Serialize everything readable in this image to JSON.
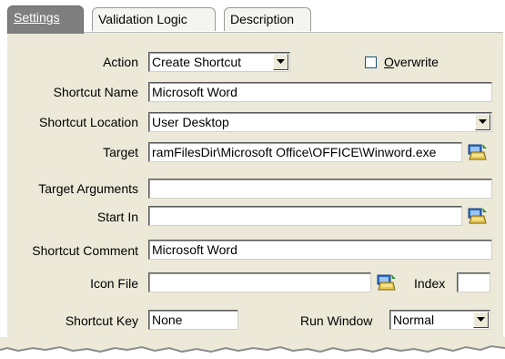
{
  "tabs": [
    {
      "label": "Settings",
      "active": true
    },
    {
      "label": "Validation Logic",
      "active": false
    },
    {
      "label": "Description",
      "active": false
    }
  ],
  "form": {
    "action": {
      "label": "Action",
      "value": "Create Shortcut"
    },
    "overwrite": {
      "label": "Overwrite",
      "checked": false
    },
    "shortcut_name": {
      "label": "Shortcut Name",
      "value": "Microsoft Word"
    },
    "shortcut_location": {
      "label": "Shortcut Location",
      "value": "User Desktop"
    },
    "target": {
      "label": "Target",
      "value": "ramFilesDir\\Microsoft Office\\OFFICE\\Winword.exe"
    },
    "target_arguments": {
      "label": "Target Arguments",
      "value": ""
    },
    "start_in": {
      "label": "Start In",
      "value": ""
    },
    "shortcut_comment": {
      "label": "Shortcut Comment",
      "value": "Microsoft Word"
    },
    "icon_file": {
      "label": "Icon File",
      "value": ""
    },
    "index": {
      "label": "Index",
      "value": ""
    },
    "shortcut_key": {
      "label": "Shortcut Key",
      "value": "None"
    },
    "run_window": {
      "label": "Run Window",
      "value": "Normal"
    }
  },
  "icons": {
    "browse": "folder-browse-icon",
    "dropdown": "chevron-down-icon"
  },
  "colors": {
    "panel_bg": "#ece9d8",
    "active_tab_bg": "#7f7f7f",
    "field_border": "#5a5a5a"
  }
}
